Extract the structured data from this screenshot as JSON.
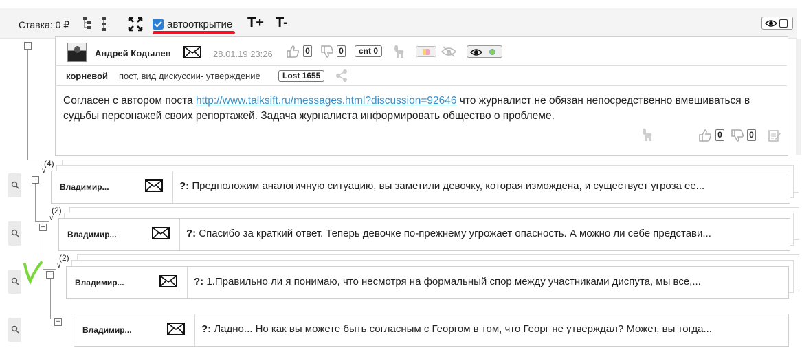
{
  "toolbar": {
    "bet_label": "Ставка: 0 ₽",
    "autoopen_label": "автооткрытие",
    "font_increase": "T+",
    "font_decrease": "T-"
  },
  "main_post": {
    "toggle": "−",
    "author": "Андрей Кодылев",
    "date": "28.01.19 23:26",
    "likes": "0",
    "dislikes": "0",
    "cnt_label": "cnt 0",
    "root_label": "корневой",
    "post_type": "пост, вид дискуссии- утверждение",
    "lost_label": "Lost 1655",
    "body_before_link": "Согласен с автором поста ",
    "body_link": "http://www.talksift.ru/messages.html?discussion=92646",
    "body_after_link": " что журналист не обязан непосредственно вмешиваться в судьбы персонажей своих репортажей. Задача журналиста информировать общество о проблеме.",
    "footer_likes": "0",
    "footer_dislikes": "0"
  },
  "replies": [
    {
      "count": "(4)",
      "toggle": "−",
      "author": "Владимир...",
      "prefix": "?:",
      "text": " Предположим аналогичную ситуацию, вы заметили девочку, которая измождена, и существует угроза ее..."
    },
    {
      "count": "(2)",
      "toggle": "−",
      "author": "Владимир...",
      "prefix": "?:",
      "text": " Спасибо за краткий ответ. Теперь девочке по-прежнему угрожает опасность. А можно ли себе представи..."
    },
    {
      "count": "(2)",
      "toggle": "−",
      "author": "Владимир...",
      "prefix": "?:",
      "text": " 1.Правильно ли я понимаю, что несмотря на формальный спор между участниками диспута, мы все,..."
    },
    {
      "count": "",
      "toggle": "+",
      "author": "Владимир...",
      "prefix": "?:",
      "text": " Ладно... Но как вы можете быть согласным с Георгом в том, что Георг не утверждал? Может, вы тогда..."
    }
  ],
  "colors": {
    "link": "#3a8fc6",
    "annotation_red": "#e8182c",
    "annotation_green": "#7ad83a",
    "checkbox": "#2d7fd3"
  },
  "icons": [
    "expand-icon",
    "tree-icon",
    "envelope-icon",
    "thumb-up-icon",
    "thumb-down-icon",
    "dog-icon",
    "eye-icon",
    "eye-off-icon",
    "share-icon",
    "edit-icon",
    "search-icon"
  ]
}
